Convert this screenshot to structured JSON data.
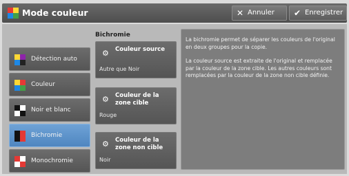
{
  "header": {
    "title": "Mode couleur",
    "cancel_label": "Annuler",
    "save_label": "Enregistrer"
  },
  "options": [
    {
      "label": "Détection auto",
      "icon": "auto-detect-icon",
      "selected": false
    },
    {
      "label": "Couleur",
      "icon": "color-icon",
      "selected": false
    },
    {
      "label": "Noir et blanc",
      "icon": "black-white-icon",
      "selected": false
    },
    {
      "label": "Bichromie",
      "icon": "bichrome-icon",
      "selected": true
    },
    {
      "label": "Monochromie",
      "icon": "monochrome-icon",
      "selected": false
    }
  ],
  "bichromie": {
    "section_label": "Bichromie",
    "source": {
      "label": "Couleur source",
      "value": "Autre que Noir"
    },
    "target": {
      "label": "Couleur de la zone cible",
      "value": "Rouge"
    },
    "non_target": {
      "label": "Couleur de la zone non cible",
      "value": "Noir"
    }
  },
  "info": {
    "paragraph1": "La bichromie permet de séparer les couleurs de l'original en deux groupes pour la copie.",
    "paragraph2": "La couleur source est extraite de l'original et remplacée par la couleur de la zone cible. Les autres couleurs sont remplacées par la couleur de la zone non cible définie."
  },
  "colors": {
    "header_bg": "#5a5a5a",
    "button_bg": "#606060",
    "selected_bg": "#5d93cb",
    "panel_bg": "#b9b9b9",
    "info_bg": "#7d7d7d"
  }
}
